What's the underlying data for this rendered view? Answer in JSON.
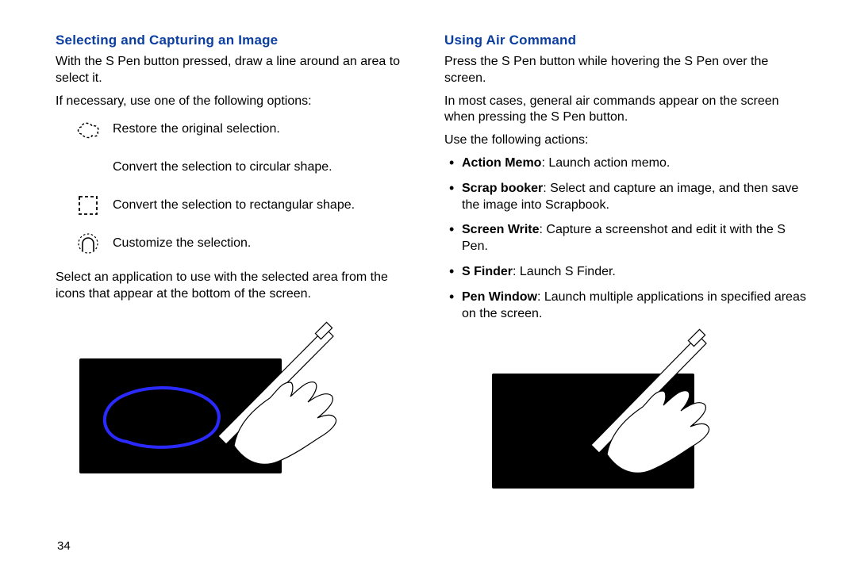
{
  "pageNumber": "34",
  "left": {
    "heading": "Selecting and Capturing an Image",
    "intro1": "With the S Pen button pressed, draw a line around an area to select it.",
    "intro2": "If necessary, use one of the following options:",
    "options": {
      "restore": "Restore the original selection.",
      "circular": "Convert the selection to circular shape.",
      "rectangular": "Convert the selection to rectangular shape.",
      "customize": "Customize the selection."
    },
    "outro": "Select an application to use with the selected area from the icons that appear at the bottom of the screen."
  },
  "right": {
    "heading": "Using Air Command",
    "intro1": "Press the S Pen button while hovering the S Pen over the screen.",
    "intro2": "In most cases, general air commands appear on the screen when pressing the S Pen button.",
    "intro3": "Use the following actions:",
    "items": {
      "actionMemo": {
        "label": "Action Memo",
        "desc": ": Launch action memo."
      },
      "scrapBooker": {
        "label": "Scrap booker",
        "desc": ": Select and capture an image, and then save the image into Scrapbook."
      },
      "screenWrite": {
        "label": "Screen Write",
        "desc": ": Capture a screenshot and edit it with the S Pen."
      },
      "sFinder": {
        "label": "S Finder",
        "desc": ": Launch S Finder."
      },
      "penWindow": {
        "label": "Pen Window",
        "desc": ": Launch multiple applications in specified areas on the screen."
      }
    }
  }
}
